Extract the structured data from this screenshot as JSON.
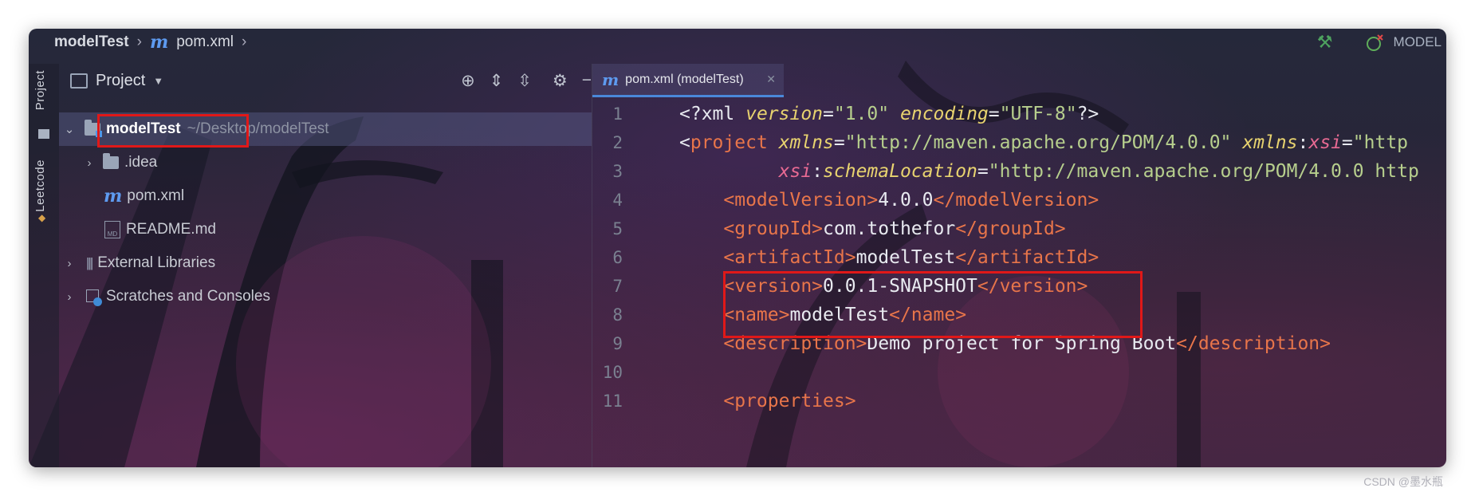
{
  "navbar": {
    "project": "modelTest",
    "file": "pom.xml",
    "run_config": "MODEL"
  },
  "stripe": {
    "project_tab": "Project",
    "leetcode_tab": "Leetcode"
  },
  "project_panel": {
    "title": "Project",
    "tree": [
      {
        "name": "modelTest",
        "path": "~/Desktop/modelTest",
        "type": "module",
        "expanded": true
      },
      {
        "name": ".idea",
        "type": "folder",
        "expanded": false
      },
      {
        "name": "pom.xml",
        "type": "maven-file"
      },
      {
        "name": "README.md",
        "type": "markdown-file"
      },
      {
        "name": "External Libraries",
        "type": "libraries"
      },
      {
        "name": "Scratches and Consoles",
        "type": "scratches"
      }
    ]
  },
  "editor": {
    "tab_label": "pom.xml (modelTest)",
    "lines": [
      {
        "n": "1",
        "parts": [
          [
            "pi",
            "<?xml "
          ],
          [
            "attr",
            "version"
          ],
          [
            "val",
            "="
          ],
          [
            "str",
            "\"1.0\""
          ],
          [
            "val",
            " "
          ],
          [
            "attr",
            "encoding"
          ],
          [
            "val",
            "="
          ],
          [
            "str",
            "\"UTF-8\""
          ],
          [
            "pi",
            "?>"
          ]
        ]
      },
      {
        "n": "2",
        "parts": [
          [
            "val",
            "<"
          ],
          [
            "tag",
            "project "
          ],
          [
            "attr",
            "xmlns"
          ],
          [
            "val",
            "="
          ],
          [
            "str",
            "\"http://maven.apache.org/POM/4.0.0\""
          ],
          [
            "val",
            " "
          ],
          [
            "attr",
            "xmlns"
          ],
          [
            "val",
            ":"
          ],
          [
            "ns",
            "xsi"
          ],
          [
            "val",
            "="
          ],
          [
            "str",
            "\"http"
          ]
        ]
      },
      {
        "n": "3",
        "parts": [
          [
            "val",
            "         "
          ],
          [
            "ns",
            "xsi"
          ],
          [
            "val",
            ":"
          ],
          [
            "attr",
            "schemaLocation"
          ],
          [
            "val",
            "="
          ],
          [
            "str",
            "\"http://maven.apache.org/POM/4.0.0 http"
          ]
        ]
      },
      {
        "n": "4",
        "parts": [
          [
            "val",
            "    "
          ],
          [
            "tag",
            "<modelVersion>"
          ],
          [
            "val",
            "4.0.0"
          ],
          [
            "tag",
            "</modelVersion>"
          ]
        ]
      },
      {
        "n": "5",
        "parts": [
          [
            "val",
            "    "
          ],
          [
            "tag",
            "<groupId>"
          ],
          [
            "val",
            "com.tothefor"
          ],
          [
            "tag",
            "</groupId>"
          ]
        ]
      },
      {
        "n": "6",
        "parts": [
          [
            "val",
            "    "
          ],
          [
            "tag",
            "<artifactId>"
          ],
          [
            "val",
            "modelTest"
          ],
          [
            "tag",
            "</artifactId>"
          ]
        ]
      },
      {
        "n": "7",
        "parts": [
          [
            "val",
            "    "
          ],
          [
            "tag",
            "<version>"
          ],
          [
            "val",
            "0.0.1-SNAPSHOT"
          ],
          [
            "tag",
            "</version>"
          ]
        ]
      },
      {
        "n": "8",
        "parts": [
          [
            "val",
            "    "
          ],
          [
            "tag",
            "<name>"
          ],
          [
            "val",
            "modelTest"
          ],
          [
            "tag",
            "</name>"
          ]
        ]
      },
      {
        "n": "9",
        "parts": [
          [
            "val",
            "    "
          ],
          [
            "tag",
            "<description>"
          ],
          [
            "val",
            "Demo project for Spring Boot"
          ],
          [
            "tag",
            "</description>"
          ]
        ]
      },
      {
        "n": "10",
        "parts": []
      },
      {
        "n": "11",
        "parts": [
          [
            "val",
            "    "
          ],
          [
            "tag",
            "<properties>"
          ]
        ]
      }
    ]
  },
  "watermark": "CSDN @墨水瓶"
}
